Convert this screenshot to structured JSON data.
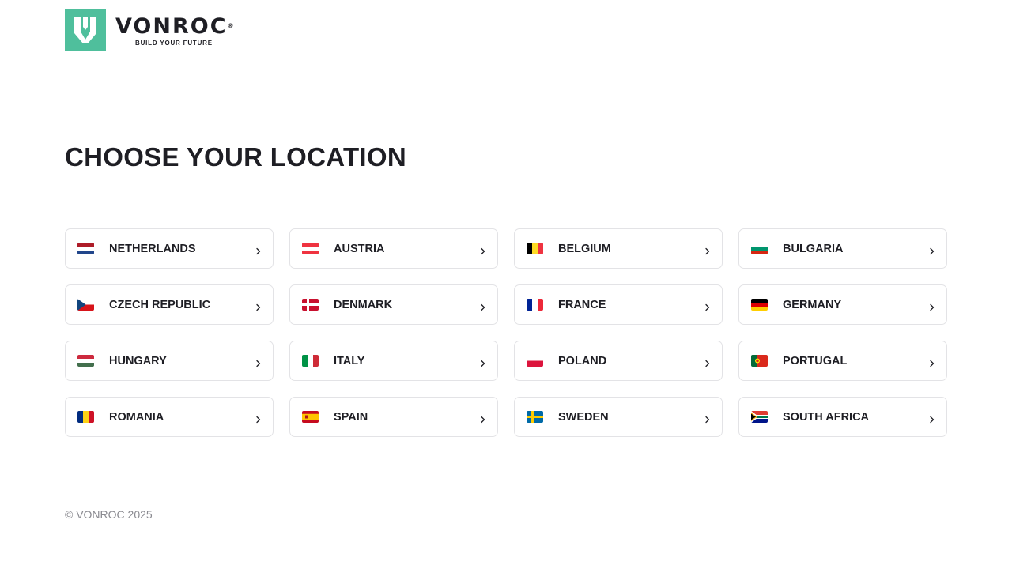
{
  "brand": {
    "name": "VONROC",
    "registered_mark": "®",
    "tagline": "BUILD YOUR FUTURE",
    "logo_color": "#4fbf9c"
  },
  "heading": "CHOOSE YOUR LOCATION",
  "countries": [
    {
      "label": "NETHERLANDS",
      "flag": "nl"
    },
    {
      "label": "AUSTRIA",
      "flag": "at"
    },
    {
      "label": "BELGIUM",
      "flag": "be"
    },
    {
      "label": "BULGARIA",
      "flag": "bg"
    },
    {
      "label": "CZECH REPUBLIC",
      "flag": "cz"
    },
    {
      "label": "DENMARK",
      "flag": "dk"
    },
    {
      "label": "FRANCE",
      "flag": "fr"
    },
    {
      "label": "GERMANY",
      "flag": "de"
    },
    {
      "label": "HUNGARY",
      "flag": "hu"
    },
    {
      "label": "ITALY",
      "flag": "it"
    },
    {
      "label": "POLAND",
      "flag": "pl"
    },
    {
      "label": "PORTUGAL",
      "flag": "pt"
    },
    {
      "label": "ROMANIA",
      "flag": "ro"
    },
    {
      "label": "SPAIN",
      "flag": "es"
    },
    {
      "label": "SWEDEN",
      "flag": "se"
    },
    {
      "label": "SOUTH AFRICA",
      "flag": "za"
    }
  ],
  "footer": {
    "copyright": "© VONROC 2025"
  }
}
